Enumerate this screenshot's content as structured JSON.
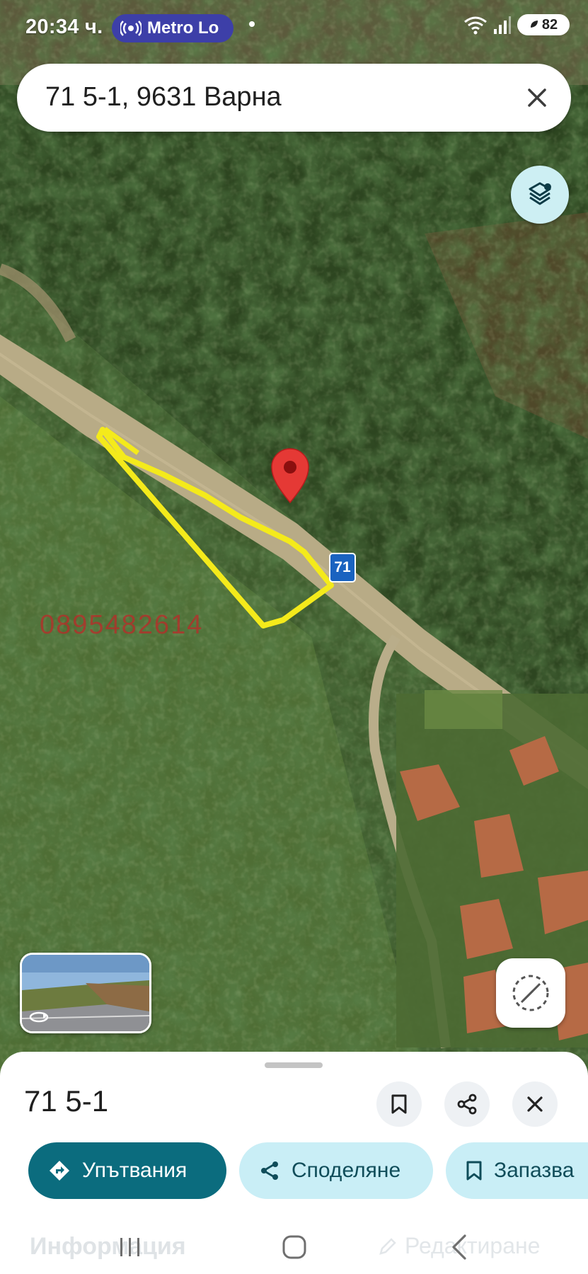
{
  "status_bar": {
    "time": "20:34 ч.",
    "media_pill_label": "Metro Lo",
    "media_pill_icon": "broadcast-icon",
    "battery_level": "82",
    "icons": [
      "wifi-icon",
      "signal-icon",
      "battery-icon"
    ]
  },
  "search": {
    "value": "71 5-1, 9631 Варна",
    "clear_icon": "close-icon"
  },
  "map": {
    "route_shield": "71",
    "watermark": "0895482614",
    "layers_icon": "layers-icon",
    "compass_icon": "compass-icon",
    "marker_icon": "location-pin-icon",
    "outline_color": "#f4ea1b",
    "pin_color": "#e53935"
  },
  "place": {
    "title": "71 5-1",
    "actions": {
      "save_icon": "bookmark-icon",
      "share_icon": "share-icon",
      "close_icon": "close-icon"
    },
    "chips": {
      "directions": "Упътвания",
      "share": "Споделяне",
      "save": "Запазва"
    },
    "faded_tab": "Информация",
    "faded_edit": "Редактиране"
  },
  "nav_bar": {
    "recents_icon": "recents-icon",
    "home_icon": "home-icon",
    "back_icon": "back-icon"
  },
  "colors": {
    "accent": "#0b6c7e",
    "chip_bg": "#c9eef6",
    "chip_text": "#104d5a",
    "status_pill": "#3d3fa8"
  }
}
